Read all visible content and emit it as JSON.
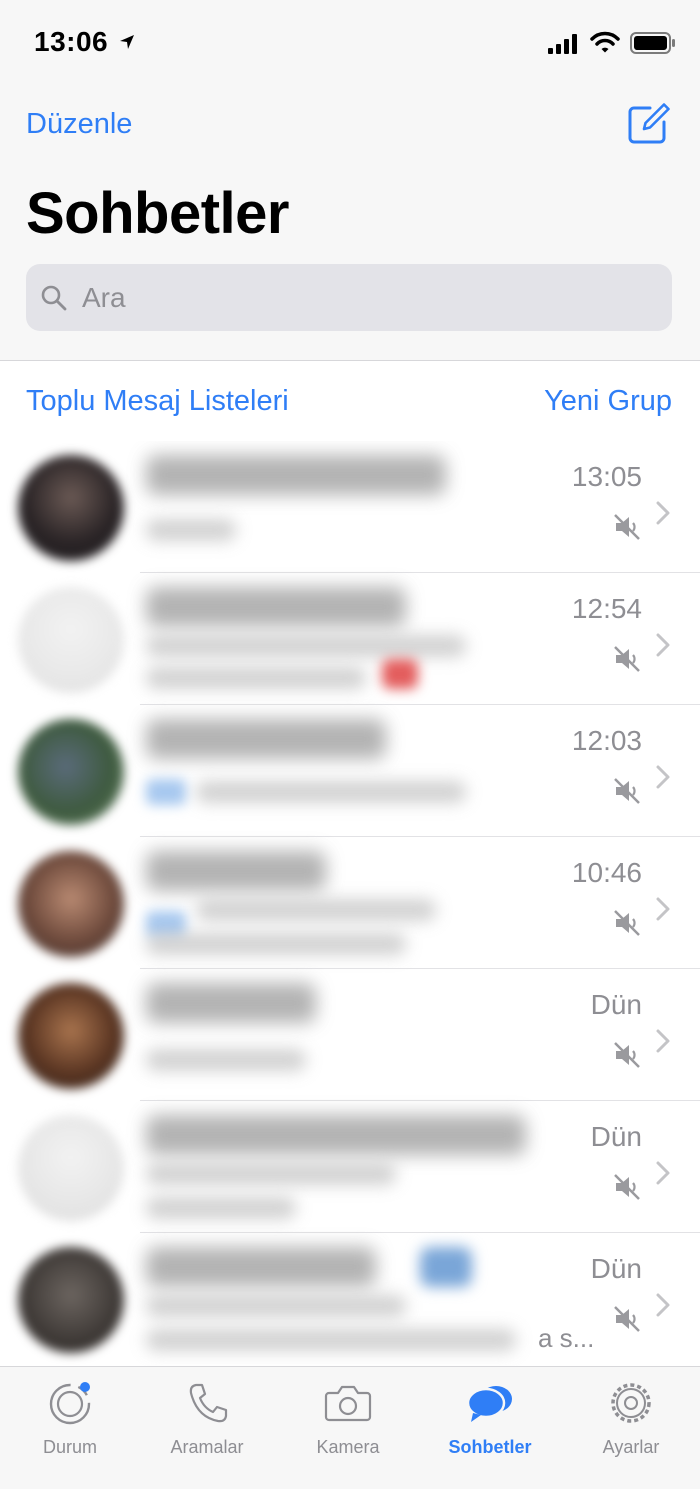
{
  "status_bar": {
    "time": "13:06",
    "icons": [
      "location-arrow-icon",
      "signal-bars-icon",
      "wifi-icon",
      "battery-icon"
    ]
  },
  "header": {
    "edit_label": "Düzenle",
    "compose_icon": "compose-icon",
    "title": "Sohbetler"
  },
  "search": {
    "placeholder": "Ara",
    "icon": "search-icon"
  },
  "actions": {
    "broadcast_label": "Toplu Mesaj Listeleri",
    "new_group_label": "Yeni Grup"
  },
  "chats": [
    {
      "time": "13:05",
      "muted": true
    },
    {
      "time": "12:54",
      "muted": true
    },
    {
      "time": "12:03",
      "muted": true
    },
    {
      "time": "10:46",
      "muted": true
    },
    {
      "time": "Dün",
      "muted": true
    },
    {
      "time": "Dün",
      "muted": true
    },
    {
      "time": "Dün",
      "muted": true,
      "preview_tail": "a s..."
    }
  ],
  "tab_bar": {
    "tabs": [
      {
        "label": "Durum",
        "icon": "status-icon",
        "active": false
      },
      {
        "label": "Aramalar",
        "icon": "phone-icon",
        "active": false
      },
      {
        "label": "Kamera",
        "icon": "camera-icon",
        "active": false
      },
      {
        "label": "Sohbetler",
        "icon": "chats-icon",
        "active": true
      },
      {
        "label": "Ayarlar",
        "icon": "settings-gear-icon",
        "active": false
      }
    ]
  },
  "colors": {
    "accent": "#2f7ef6",
    "secondary_text": "#8e8e93",
    "background": "#f7f7f7",
    "search_bg": "#e3e3e8"
  }
}
